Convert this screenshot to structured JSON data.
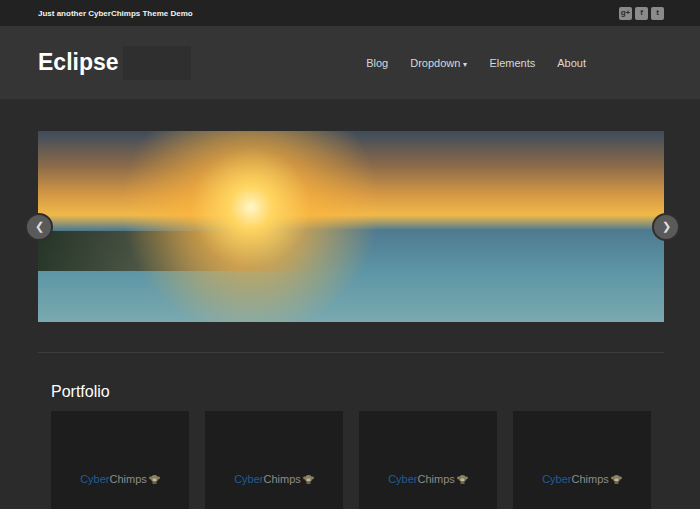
{
  "top_bar": {
    "tagline": "Just another CyberChimps Theme Demo",
    "social": [
      {
        "label": "g+",
        "color": "#8a8a8a"
      },
      {
        "label": "f",
        "color": "#8a8a8a"
      },
      {
        "label": "t",
        "color": "#8a8a8a"
      }
    ]
  },
  "header": {
    "logo": "Eclipse",
    "nav": [
      {
        "label": "Blog",
        "caret": ""
      },
      {
        "label": "Dropdown",
        "caret": "▾"
      },
      {
        "label": "Elements",
        "caret": ""
      },
      {
        "label": "About",
        "caret": ""
      }
    ]
  },
  "slider": {
    "prev": "❮",
    "next": "❯"
  },
  "portfolio": {
    "title": "Portfolio",
    "items": [
      {
        "brand_a": "Cyber",
        "brand_b": "Chimps"
      },
      {
        "brand_a": "Cyber",
        "brand_b": "Chimps"
      },
      {
        "brand_a": "Cyber",
        "brand_b": "Chimps"
      },
      {
        "brand_a": "Cyber",
        "brand_b": "Chimps"
      }
    ]
  }
}
